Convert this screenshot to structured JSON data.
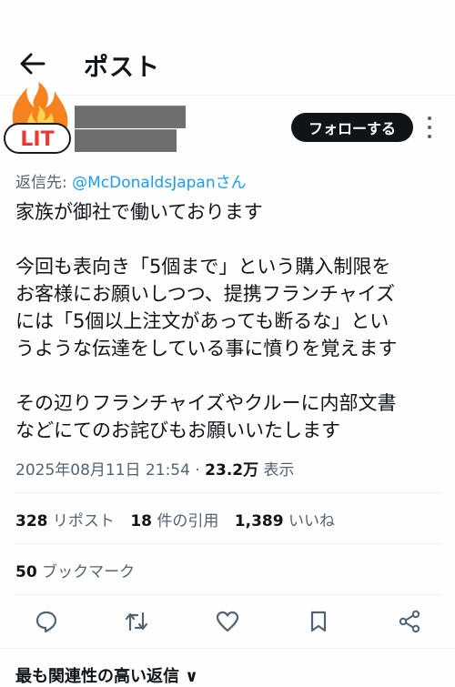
{
  "header": {
    "title": "ポスト"
  },
  "sticker": {
    "text": "LIT"
  },
  "follow_label": "フォローする",
  "post": {
    "reply_prefix": "返信先: ",
    "reply_to": "@McDonaldsJapanさん",
    "lines": [
      "家族が御社で働いております",
      "",
      "今回も表向き「5個まで」という購入制限を",
      "お客様にお願いしつつ、提携フランチャイズ",
      "には「5個以上注文があっても断るな」とい",
      "うような伝達をしている事に憤りを覚えます",
      "",
      "その辺りフランチャイズやクルーに内部文書",
      "などにてのお詫びもお願いいたします"
    ],
    "timestamp": "2025年08月11日 21:54",
    "separator": " · ",
    "views_count": "23.2万",
    "views_label": " 表示"
  },
  "stats": {
    "reposts_count": "328",
    "reposts_label": "リポスト",
    "quotes_count": "18",
    "quotes_label": "件の引用",
    "likes_count": "1,389",
    "likes_label": "いいね",
    "bookmarks_count": "50",
    "bookmarks_label": "ブックマーク"
  },
  "actions": [
    "reply-icon",
    "repost-icon",
    "like-icon",
    "bookmark-icon",
    "share-icon"
  ],
  "footer": {
    "partial_text": "最も関連性の高い返信 ∨"
  },
  "colors": {
    "text": "#0f1419",
    "secondary": "#536471",
    "link": "#1d9bf0",
    "divider": "#eff3f4",
    "redaction": "#6e6e6e"
  }
}
